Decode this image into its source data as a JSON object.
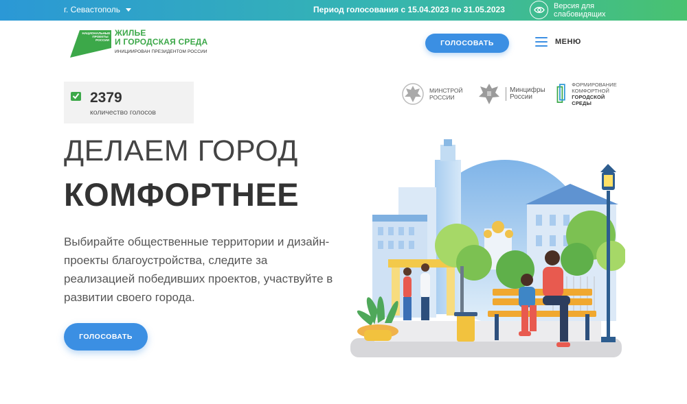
{
  "topbar": {
    "city": "г. Севастополь",
    "period": "Период голосования с 15.04.2023 по 31.05.2023",
    "vision_label": "Версия для слабовидящих"
  },
  "header": {
    "logo_small": [
      "НАЦИОНАЛЬНЫЕ",
      "ПРОЕКТЫ",
      "РОССИИ"
    ],
    "logo_title_line1": "ЖИЛЬЕ",
    "logo_title_line2": "И ГОРОДСКАЯ СРЕДА",
    "logo_subtitle": "ИНИЦИИРОВАН ПРЕЗИДЕНТОМ РОССИИ",
    "vote_button": "ГОЛОСОВАТЬ",
    "menu_label": "МЕНЮ"
  },
  "counter": {
    "value": "2379",
    "label": "количество голосов"
  },
  "partners": {
    "minstroy": [
      "МИНСТРОЙ",
      "РОССИИ"
    ],
    "mintsifry": [
      "Минцифры",
      "России"
    ],
    "fks": [
      "ФОРМИРОВАНИЕ",
      "КОМФОРТНОЙ",
      "ГОРОДСКОЙ СРЕДЫ"
    ]
  },
  "hero": {
    "title_line1": "ДЕЛАЕМ ГОРОД",
    "title_line2": "КОМФОРТНЕЕ",
    "description": "Выбирайте общественные территории и дизайн-проекты благоустройства, следите за реализацией победивших проектов, участвуйте в развитии своего города.",
    "vote_button": "ГОЛОСОВАТЬ"
  },
  "colors": {
    "accent_blue": "#3b8fe3",
    "brand_green": "#3ca849",
    "topbar_gradient": [
      "#2b98d6",
      "#49c270"
    ]
  }
}
